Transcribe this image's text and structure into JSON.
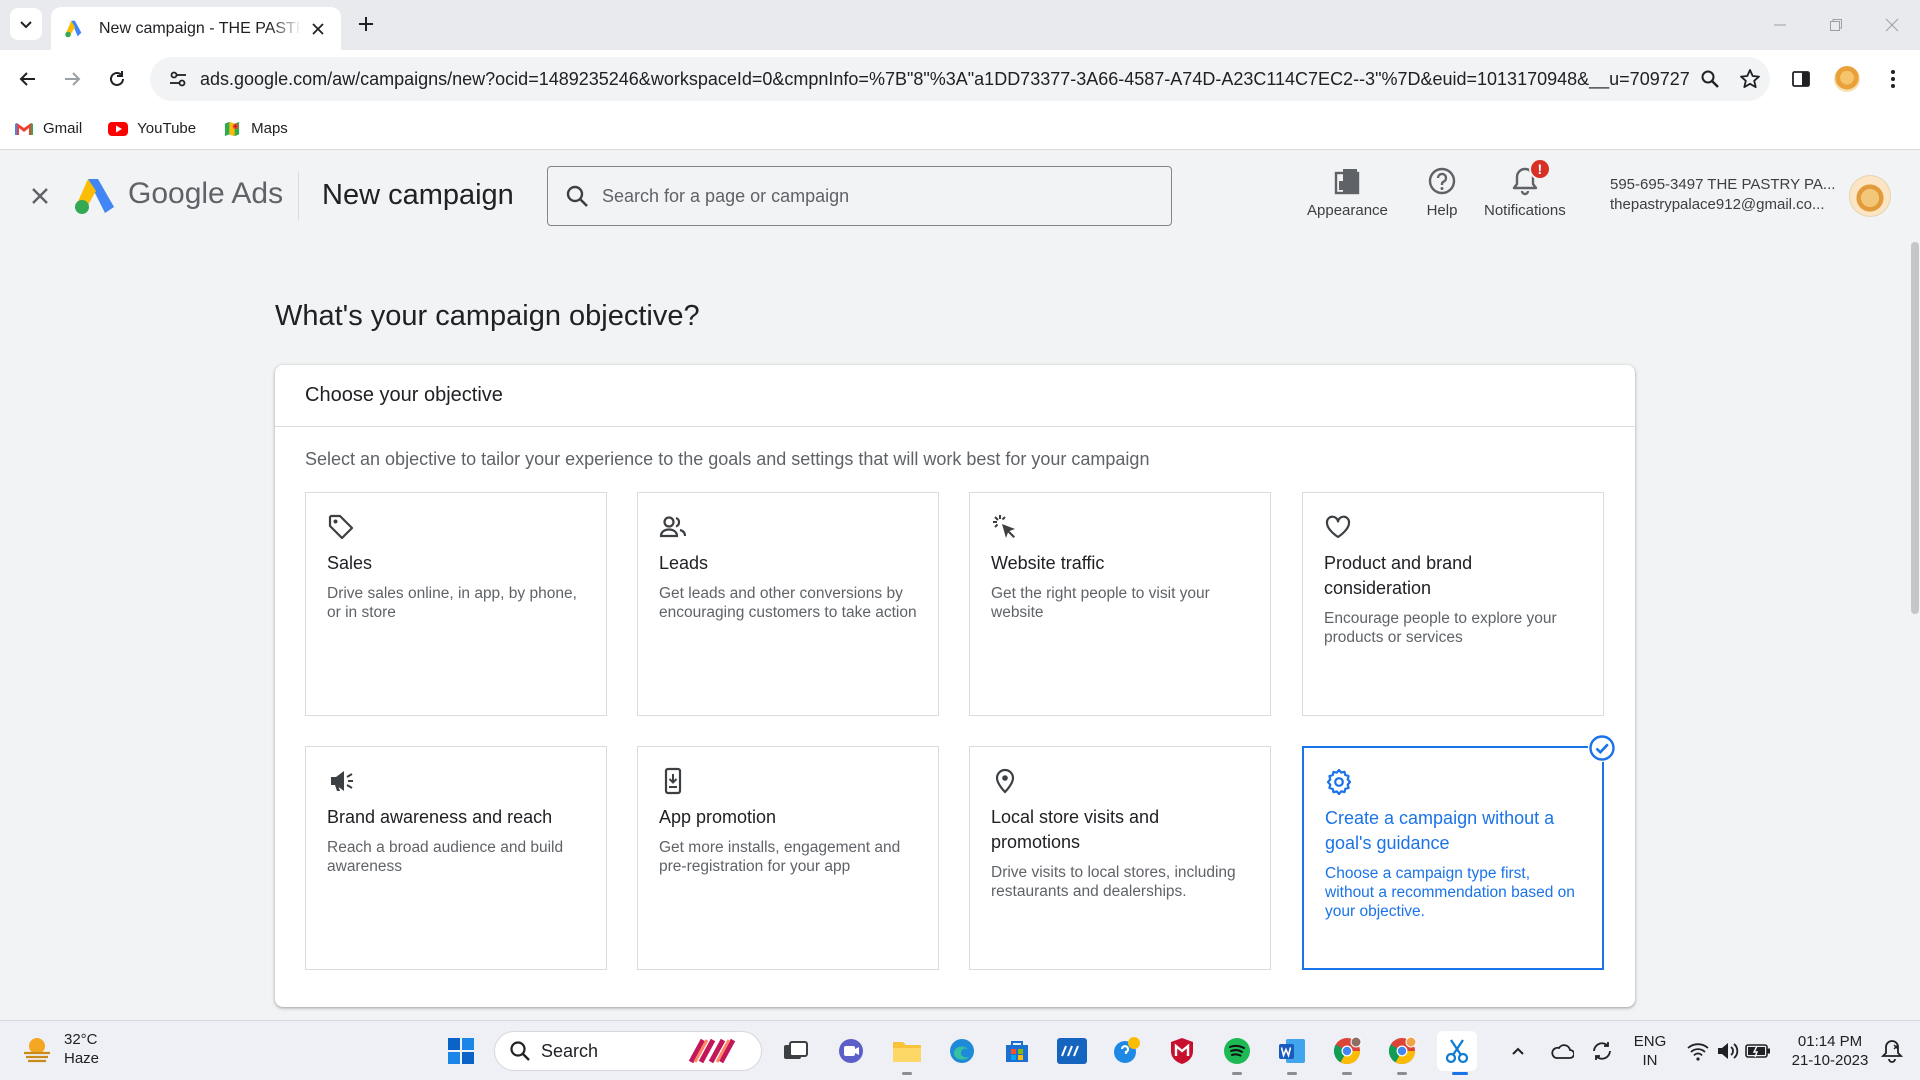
{
  "browser": {
    "tab_title": "New campaign - THE PASTRY PALACE",
    "url": "ads.google.com/aw/campaigns/new?ocid=1489235246&workspaceId=0&cmpnInfo=%7B\"8\"%3A\"a1DD73377-3A66-4587-A74D-A23C114C7EC2--3\"%7D&euid=1013170948&__u=709727485...",
    "bookmarks": [
      {
        "label": "Gmail",
        "icon": "gmail-icon"
      },
      {
        "label": "YouTube",
        "icon": "youtube-icon"
      },
      {
        "label": "Maps",
        "icon": "maps-icon"
      }
    ]
  },
  "header": {
    "brand": "Google Ads",
    "page_title": "New campaign",
    "search_placeholder": "Search for a page or campaign",
    "actions": {
      "appearance": "Appearance",
      "help": "Help",
      "notifications": "Notifications",
      "notification_badge": "!"
    },
    "account": {
      "line1": "595-695-3497 THE PASTRY PA...",
      "line2": "thepastrypalace912@gmail.co..."
    }
  },
  "main": {
    "question": "What's your campaign objective?",
    "card_title": "Choose your objective",
    "card_subtitle": "Select an objective to tailor your experience to the goals and settings that will work best for your campaign",
    "objectives": [
      {
        "title": "Sales",
        "desc": "Drive sales online, in app, by phone, or in store",
        "icon": "tag-icon",
        "selected": false
      },
      {
        "title": "Leads",
        "desc": "Get leads and other conversions by encouraging customers to take action",
        "icon": "people-icon",
        "selected": false
      },
      {
        "title": "Website traffic",
        "desc": "Get the right people to visit your website",
        "icon": "cursor-click-icon",
        "selected": false
      },
      {
        "title": "Product and brand consideration",
        "desc": "Encourage people to explore your products or services",
        "icon": "heart-icon",
        "selected": false
      },
      {
        "title": "Brand awareness and reach",
        "desc": "Reach a broad audience and build awareness",
        "icon": "megaphone-icon",
        "selected": false
      },
      {
        "title": "App promotion",
        "desc": "Get more installs, engagement and pre-registration for your app",
        "icon": "phone-download-icon",
        "selected": false
      },
      {
        "title": "Local store visits and promotions",
        "desc": "Drive visits to local stores, including restaurants and dealerships.",
        "icon": "location-pin-icon",
        "selected": false
      },
      {
        "title": "Create a campaign without a goal's guidance",
        "desc": "Choose a campaign type first, without a recommendation based on your objective.",
        "icon": "gear-icon",
        "selected": true
      }
    ]
  },
  "taskbar": {
    "weather_temp": "32°C",
    "weather_cond": "Haze",
    "search_label": "Search",
    "lang_line1": "ENG",
    "lang_line2": "IN",
    "time": "01:14 PM",
    "date": "21-10-2023"
  },
  "colors": {
    "accent": "#1a73e8",
    "badge": "#d93025",
    "page_bg": "#f1f3f4"
  }
}
